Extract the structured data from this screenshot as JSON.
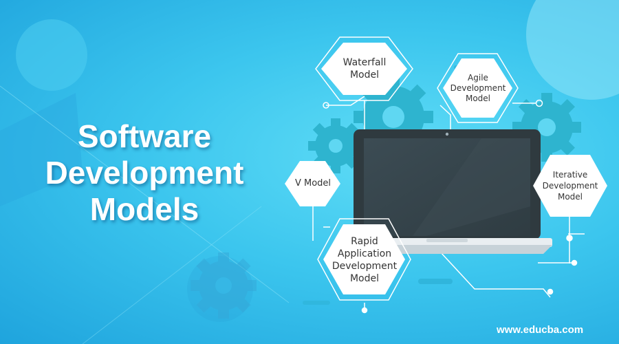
{
  "banner": {
    "title_lines": [
      "Software",
      "Development",
      "Models"
    ],
    "website": "www.educba.com"
  },
  "models": {
    "waterfall": [
      "Waterfall",
      "Model"
    ],
    "agile": [
      "Agile",
      "Development",
      "Model"
    ],
    "v_model": [
      "V Model"
    ],
    "iterative": [
      "Iterative",
      "Development",
      "Model"
    ],
    "rad": [
      "Rapid",
      "Application",
      "Development",
      "Model"
    ]
  },
  "colors": {
    "background": "#3cc6ee",
    "gear": "#2eb4cf",
    "laptop_body": "#2f3a3f",
    "laptop_screen": "#37474f",
    "laptop_base": "#e9eef1",
    "hexagon": "#ffffff",
    "connector": "#ffffff"
  },
  "icons": [
    "gear-icon",
    "laptop-icon",
    "hexagon-icon"
  ]
}
